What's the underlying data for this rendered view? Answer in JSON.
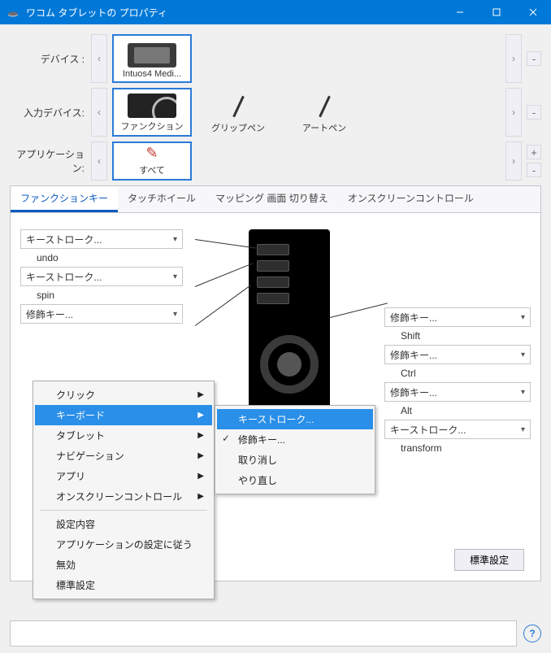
{
  "window": {
    "title": "ワコム タブレットの プロパティ"
  },
  "rows": {
    "device": {
      "label": "デバイス :",
      "items": [
        "Intuos4 Medi..."
      ],
      "selected": 0
    },
    "tool": {
      "label": "入力デバイス:",
      "items": [
        "ファンクション",
        "グリップペン",
        "アートペン"
      ],
      "selected": 0
    },
    "app": {
      "label": "アプリケーション:",
      "items": [
        "すべて"
      ],
      "selected": 0
    }
  },
  "tabs": {
    "items": [
      "ファンクションキー",
      "タッチホイール",
      "マッピング 画面 切り替え",
      "オンスクリーンコントロール"
    ],
    "active": 0
  },
  "left_keys": [
    {
      "combo": "キーストローク...",
      "sub": "undo"
    },
    {
      "combo": "キーストローク...",
      "sub": "spin"
    },
    {
      "combo": "修飾キー...",
      "sub": ""
    }
  ],
  "right_keys": [
    {
      "combo": "修飾キー...",
      "sub": "Shift"
    },
    {
      "combo": "修飾キー...",
      "sub": "Ctrl"
    },
    {
      "combo": "修飾キー...",
      "sub": "Alt"
    },
    {
      "combo": "キーストローク...",
      "sub": "transform"
    }
  ],
  "default_button": "標準設定",
  "context_menu": {
    "items": [
      {
        "label": "クリック",
        "submenu": true
      },
      {
        "label": "キーボード",
        "submenu": true,
        "hovered": true
      },
      {
        "label": "タブレット",
        "submenu": true
      },
      {
        "label": "ナビゲーション",
        "submenu": true
      },
      {
        "label": "アプリ",
        "submenu": true
      },
      {
        "label": "オンスクリーンコントロール",
        "submenu": true
      },
      {
        "sep": true
      },
      {
        "label": "設定内容"
      },
      {
        "label": "アプリケーションの設定に従う"
      },
      {
        "label": "無効"
      },
      {
        "label": "標準設定"
      }
    ],
    "sub": [
      {
        "label": "キーストローク...",
        "hovered": true
      },
      {
        "label": "修飾キー...",
        "checked": true
      },
      {
        "label": "取り消し"
      },
      {
        "label": "やり直し"
      }
    ]
  }
}
